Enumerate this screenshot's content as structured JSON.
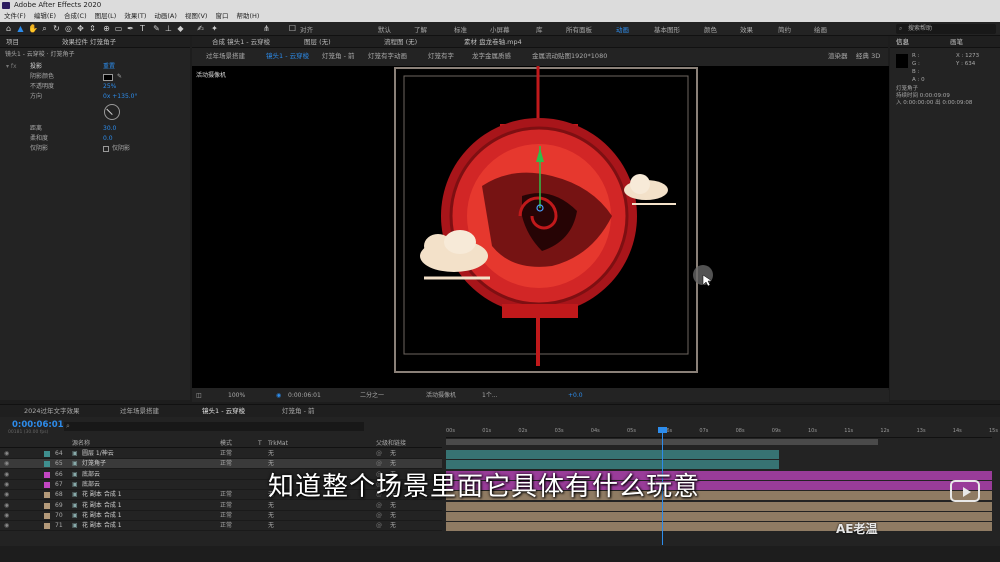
{
  "titlebar": {
    "title": "Adobe After Effects 2020"
  },
  "menu": [
    "文件(F)",
    "编辑(E)",
    "合成(C)",
    "图层(L)",
    "效果(T)",
    "动画(A)",
    "视图(V)",
    "窗口",
    "帮助(H)"
  ],
  "toolbar": {
    "align_label": "对齐",
    "workspaces": [
      "默认",
      "了解",
      "标准",
      "小屏幕",
      "库",
      "所有面板",
      "动画",
      "基本图形",
      "颜色",
      "效果",
      "简约",
      "绘画"
    ],
    "active_workspace": "动画",
    "search_placeholder": "搜索帮助"
  },
  "left_panel": {
    "tabs": [
      "项目",
      "效果控件 灯笼角子"
    ],
    "breadcrumb": "镜头1 - 云穿梭 · 灯笼角子",
    "effect_name": "投影",
    "reset_label": "重置",
    "props": [
      {
        "name": "阴影颜色",
        "value": ""
      },
      {
        "name": "不透明度",
        "value": "25%"
      },
      {
        "name": "方向",
        "value": "0x +135.0°"
      },
      {
        "name": "距离",
        "value": "30.0"
      },
      {
        "name": "柔和度",
        "value": "0.0"
      },
      {
        "name": "仅阴影",
        "value": "仅阴影"
      }
    ]
  },
  "comp_panel": {
    "tabs": [
      "合成 镜头1 - 云穿梭",
      "图层 (无)",
      "流程图 (无)",
      "素材 盘龙卷轴.mp4"
    ],
    "breadcrumbs": [
      "过年场景搭建",
      "镜头1 - 云穿梭",
      "灯笼角 - 前",
      "灯笼有字动画",
      "灯笼有字",
      "龙字金属质感",
      "金属流动贴图1920*1080"
    ],
    "renderer_label": "渲染器",
    "renderer_value": "经典 3D",
    "camera_label": "活动摄像机",
    "zoom": "100%",
    "timecode": "0:00:06:01",
    "resolution": "二分之一",
    "camera_select": "活动摄像机",
    "views": "1个...",
    "exposure": "+0.0"
  },
  "right_panel": {
    "tabs": [
      "信息",
      "画笔"
    ],
    "rgb": [
      "R :",
      "G :",
      "B :",
      "A : 0"
    ],
    "coords": [
      "X : 1273",
      "Y : 634"
    ],
    "layer_name": "灯笼角子",
    "duration_label": "持续时间",
    "duration": "0:00:09:09",
    "in_label": "入",
    "in_time": "0:00:00:00",
    "out_label": "出",
    "out_time": "0:00:09:08"
  },
  "timeline": {
    "tabs": [
      "2024过年文字效果",
      "过年场景搭建",
      "镜头1 - 云穿梭",
      "灯笼角 - 前"
    ],
    "active_tab": "镜头1 - 云穿梭",
    "timecode": "0:00:06:01",
    "timecode_sub": "00181 (30.00 fps)",
    "headers": {
      "name": "源名称",
      "mode": "模式",
      "t": "T",
      "trkmat": "TrkMat",
      "parent": "父级和链接"
    },
    "ruler": [
      "00s",
      "01s",
      "02s",
      "03s",
      "04s",
      "05s",
      "06s",
      "07s",
      "08s",
      "09s",
      "10s",
      "11s",
      "12s",
      "13s",
      "14s",
      "15s"
    ],
    "layers": [
      {
        "num": "64",
        "name": "圆层 1/神云",
        "mode": "正常",
        "trk": "无",
        "parent": "无",
        "color": "#3f8f8f"
      },
      {
        "num": "65",
        "name": "灯笼角子",
        "mode": "正常",
        "trk": "无",
        "parent": "无",
        "color": "#3f8f8f"
      },
      {
        "num": "66",
        "name": "底部云",
        "mode": "",
        "trk": "",
        "parent": "无",
        "color": "#c246c2"
      },
      {
        "num": "67",
        "name": "底部云",
        "mode": "",
        "trk": "",
        "parent": "无",
        "color": "#c246c2"
      },
      {
        "num": "68",
        "name": "花 副本 合成 1",
        "mode": "正常",
        "trk": "无",
        "parent": "无",
        "color": "#b49a7a"
      },
      {
        "num": "69",
        "name": "花 副本 合成 1",
        "mode": "正常",
        "trk": "无",
        "parent": "无",
        "color": "#b49a7a"
      },
      {
        "num": "70",
        "name": "花 副本 合成 1",
        "mode": "正常",
        "trk": "无",
        "parent": "无",
        "color": "#b49a7a"
      },
      {
        "num": "71",
        "name": "花 副本 合成 1",
        "mode": "正常",
        "trk": "无",
        "parent": "无",
        "color": "#b49a7a"
      }
    ]
  },
  "caption": "知道整个场景里面它具体有什么玩意",
  "watermark": "AE老温"
}
